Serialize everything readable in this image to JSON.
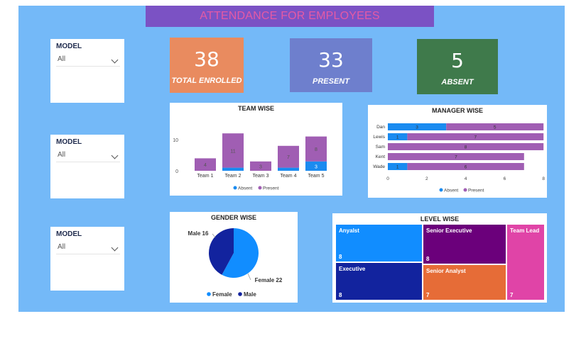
{
  "title": "ATTENDANCE FOR EMPLOYEES",
  "slicers": [
    {
      "label": "MODEL",
      "value": "All"
    },
    {
      "label": "MODEL",
      "value": "All"
    },
    {
      "label": "MODEL",
      "value": "All"
    }
  ],
  "kpis": [
    {
      "value": "38",
      "caption": "TOTAL ENROLLED",
      "color": "#e98b5f"
    },
    {
      "value": "33",
      "caption": "PRESENT",
      "color": "#6e7fcd"
    },
    {
      "value": "5",
      "caption": "ABSENT",
      "color": "#3f7a4b"
    }
  ],
  "colors": {
    "absent": "#1a8bf0",
    "present": "#a05eb3"
  },
  "chart_data": [
    {
      "type": "bar",
      "title": "TEAM WISE",
      "categories": [
        "Team 1",
        "Team 2",
        "Team 3",
        "Team 4",
        "Team 5"
      ],
      "series": [
        {
          "name": "Absent",
          "values": [
            0,
            1,
            0,
            1,
            3
          ]
        },
        {
          "name": "Present",
          "values": [
            4,
            11,
            3,
            7,
            8
          ]
        }
      ],
      "stacked": true,
      "yticks": [
        0,
        10
      ],
      "legend": "bottom"
    },
    {
      "type": "bar",
      "orientation": "horizontal",
      "title": "MANAGER WISE",
      "categories": [
        "Dan",
        "Lewis",
        "Sam",
        "Kent",
        "Wade"
      ],
      "series": [
        {
          "name": "Absent",
          "values": [
            3,
            1,
            0,
            0,
            1
          ]
        },
        {
          "name": "Present",
          "values": [
            5,
            7,
            8,
            7,
            6
          ]
        }
      ],
      "stacked": true,
      "xticks": [
        0,
        2,
        4,
        6,
        8
      ],
      "xlim": [
        0,
        8
      ],
      "legend": "bottom"
    },
    {
      "type": "pie",
      "title": "GENDER WISE",
      "slices": [
        {
          "name": "Female",
          "value": 22,
          "label": "Female 22",
          "color": "#118dff"
        },
        {
          "name": "Male",
          "value": 16,
          "label": "Male 16",
          "color": "#12239e"
        }
      ],
      "legend": "bottom"
    },
    {
      "type": "treemap",
      "title": "LEVEL WISE",
      "items": [
        {
          "name": "Anyalst",
          "value": 8,
          "color": "#118dff"
        },
        {
          "name": "Executive",
          "value": 8,
          "color": "#12239e"
        },
        {
          "name": "Senior Executive",
          "value": 8,
          "color": "#6b007b"
        },
        {
          "name": "Senior Analyst",
          "value": 7,
          "color": "#e66c37"
        },
        {
          "name": "Team Lead",
          "value": 7,
          "color": "#e044a7"
        }
      ]
    }
  ]
}
